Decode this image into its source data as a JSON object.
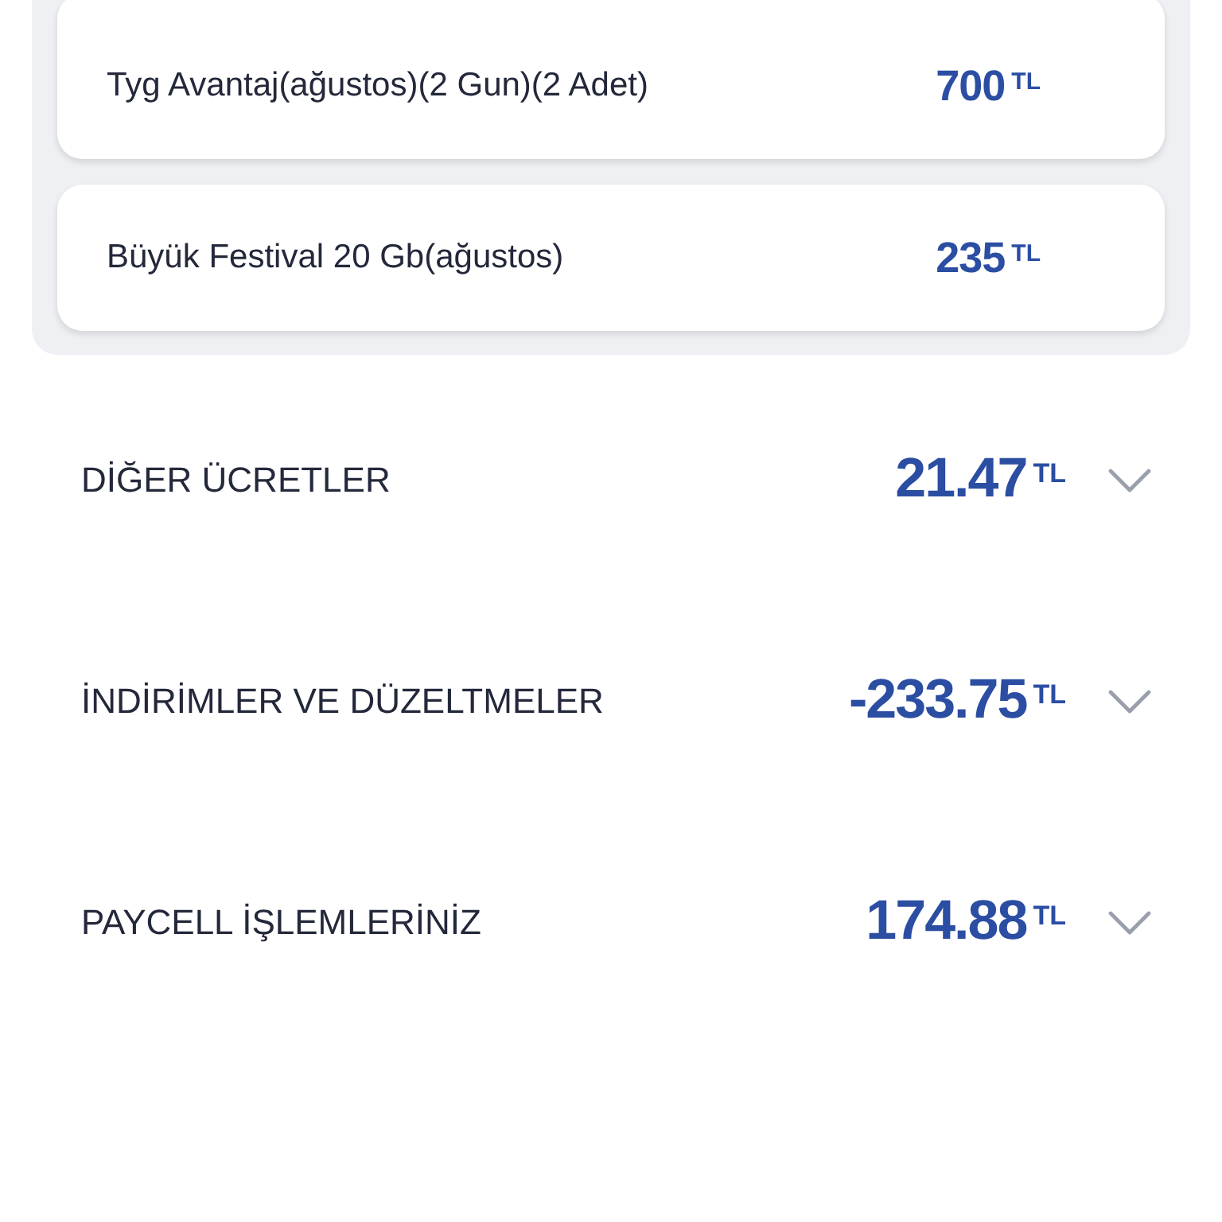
{
  "packages": [
    {
      "name": "Tyg Avantaj(ağustos)(2 Gun)(2 Adet)",
      "amount": "700",
      "currency": "TL"
    },
    {
      "name": "Büyük Festival 20 Gb(ağustos)",
      "amount": "235",
      "currency": "TL"
    }
  ],
  "sections": [
    {
      "title": "DİĞER ÜCRETLER",
      "amount": "21.47",
      "currency": "TL",
      "expanded": false
    },
    {
      "title": "İNDİRİMLER VE DÜZELTMELER",
      "amount": "-233.75",
      "currency": "TL",
      "expanded": false
    },
    {
      "title": "PAYCELL İŞLEMLERİNİZ",
      "amount": "174.88",
      "currency": "TL",
      "expanded": false
    }
  ]
}
